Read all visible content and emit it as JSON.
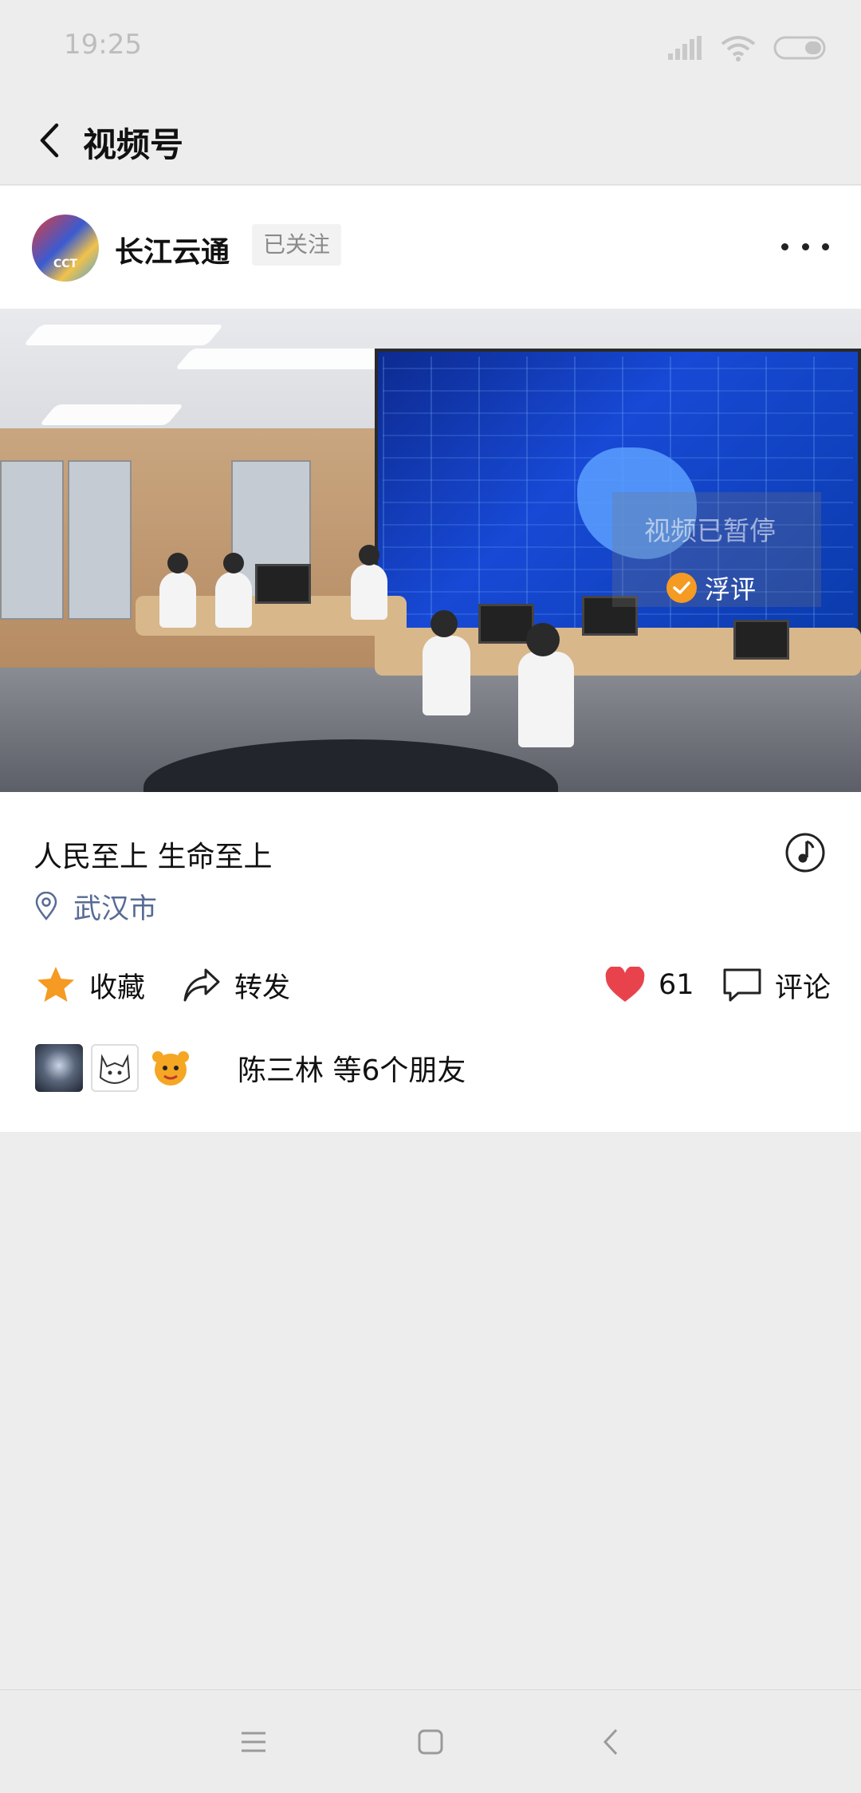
{
  "status_bar": {
    "time": "19:25",
    "icons": [
      "signal-icon",
      "wifi-icon",
      "battery-icon"
    ]
  },
  "nav": {
    "title": "视频号",
    "back_icon": "chevron-left-icon"
  },
  "author": {
    "name": "长江云通",
    "follow_status": "已关注",
    "avatar_text": "CCT"
  },
  "video": {
    "paused_text": "视频已暂停",
    "float_comment_label": "浮评",
    "float_comment_checked": true,
    "progress": 0.35
  },
  "post": {
    "caption": "人民至上 生命至上",
    "location": "武汉市"
  },
  "actions": {
    "favorite_label": "收藏",
    "share_label": "转发",
    "like_count": "61",
    "comment_label": "评论"
  },
  "friends": {
    "text": "陈三林 等6个朋友"
  },
  "colors": {
    "accent": "#f59a23",
    "link": "#576b95",
    "like": "#e8434d"
  }
}
